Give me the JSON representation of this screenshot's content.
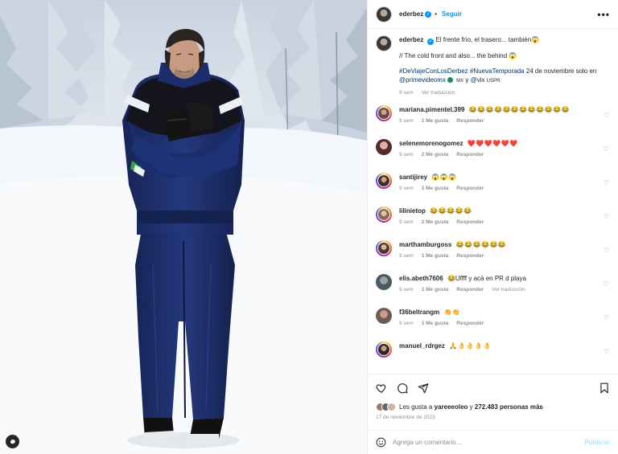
{
  "post": {
    "owner": "ederbez",
    "follow_label": "Seguir",
    "more_label": "•••",
    "caption_es": "El frente frío, el trasero... también",
    "caption_es_emoji": "😱",
    "caption_en": "// The cold front and also... the behind",
    "caption_en_emoji": "😱",
    "hashtags": "#DeViajeConLosDerbez #NuevaTemporada",
    "caption_rest_1": "24 de noviembre solo en",
    "mention_1": "@primevideomx",
    "small_mx": "MX",
    "caption_and": "y",
    "mention_2": "@vix",
    "small_uspr": "USPR",
    "caption_time": "9 sem",
    "see_translation": "Ver traducción"
  },
  "comments": [
    {
      "user": "mariana.pimentel.399",
      "text": "😂😂😂😂😂😂😂😂😂😂😂😂",
      "time": "9 sem",
      "likes": "1 Me gusta",
      "reply": "Responder",
      "translate": ""
    },
    {
      "user": "selenemorenogomez",
      "text": "❤️❤️❤️❤️❤️❤️",
      "time": "9 sem",
      "likes": "2 Me gusta",
      "reply": "Responder",
      "translate": ""
    },
    {
      "user": "santijirey",
      "text": "😱😱😱",
      "time": "9 sem",
      "likes": "1 Me gusta",
      "reply": "Responder",
      "translate": ""
    },
    {
      "user": "lilinietop",
      "text": "😂😂😂😂😂",
      "time": "9 sem",
      "likes": "2 Me gusta",
      "reply": "Responder",
      "translate": ""
    },
    {
      "user": "marthamburgoss",
      "text": "😂😂😂😂😂😂",
      "time": "9 sem",
      "likes": "1 Me gusta",
      "reply": "Responder",
      "translate": ""
    },
    {
      "user": "elis.abeth7606",
      "text": "😂Uffff y acá en PR d playa",
      "time": "9 sem",
      "likes": "1 Me gusta",
      "reply": "Responder",
      "translate": "Ver traducción"
    },
    {
      "user": "f36beltrangm",
      "text": "👏👏",
      "time": "9 sem",
      "likes": "1 Me gusta",
      "reply": "Responder",
      "translate": ""
    },
    {
      "user": "manuel_rdrgez",
      "text": "🙏👌👌👌👌",
      "time": "",
      "likes": "",
      "reply": "",
      "translate": ""
    }
  ],
  "likes": {
    "prefix": "Les gusta a",
    "user": "yareeeoleo",
    "mid": "y",
    "count": "272.483 personas más"
  },
  "date": "17 de noviembre de 2023",
  "composer": {
    "placeholder": "Agrega un comentario...",
    "publish": "Publicar"
  },
  "colors": {
    "link": "#0095f6",
    "hashtag": "#00376b",
    "muted": "#8e8e8e",
    "suit_navy": "#1f2f6d",
    "suit_dark": "#141c3d"
  }
}
